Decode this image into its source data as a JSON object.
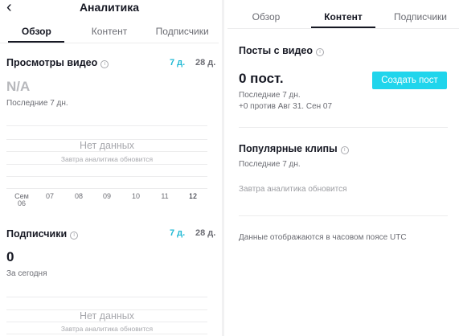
{
  "left": {
    "header": {
      "back_glyph": "‹",
      "title": "Аналитика"
    },
    "tabs": [
      {
        "label": "Обзор",
        "active": true
      },
      {
        "label": "Контент",
        "active": false
      },
      {
        "label": "Подписчики",
        "active": false
      }
    ],
    "video_views": {
      "title": "Просмотры видео",
      "ranges": [
        "7 д.",
        "28 д."
      ],
      "value": "N/A",
      "period": "Последние 7 дн.",
      "no_data": "Нет данных",
      "no_data_sub": "Завтра аналитика обновится",
      "x_ticks": [
        [
          "Сем",
          "06"
        ],
        [
          "07"
        ],
        [
          "08"
        ],
        [
          "09"
        ],
        [
          "10"
        ],
        [
          "11"
        ],
        [
          "12"
        ]
      ]
    },
    "followers": {
      "title": "Подписчики",
      "ranges": [
        "7 д.",
        "28 д."
      ],
      "value": "0",
      "period": "За сегодня",
      "no_data": "Нет данных",
      "no_data_sub": "Завтра аналитика обновится"
    }
  },
  "right": {
    "tabs": [
      {
        "label": "Обзор",
        "active": false
      },
      {
        "label": "Контент",
        "active": true
      },
      {
        "label": "Подписчики",
        "active": false
      }
    ],
    "video_posts": {
      "title": "Посты с видео",
      "value": "0 пост.",
      "button": "Создать пост",
      "period": "Последние 7 дн.",
      "compare": "+0 против Авг 31. Сен 07"
    },
    "popular_clips": {
      "title": "Популярные клипы",
      "period": "Последние 7 дн.",
      "note": "Завтра аналитика обновится"
    },
    "footer_note": "Данные отображаются в часовом поясе UTC"
  },
  "colors": {
    "accent": "#20b9d4",
    "button": "#20d5ec",
    "text": "#161823",
    "muted": "#6b6c73"
  },
  "icons": {
    "back": "chevron-left-icon",
    "info": "info-icon"
  }
}
